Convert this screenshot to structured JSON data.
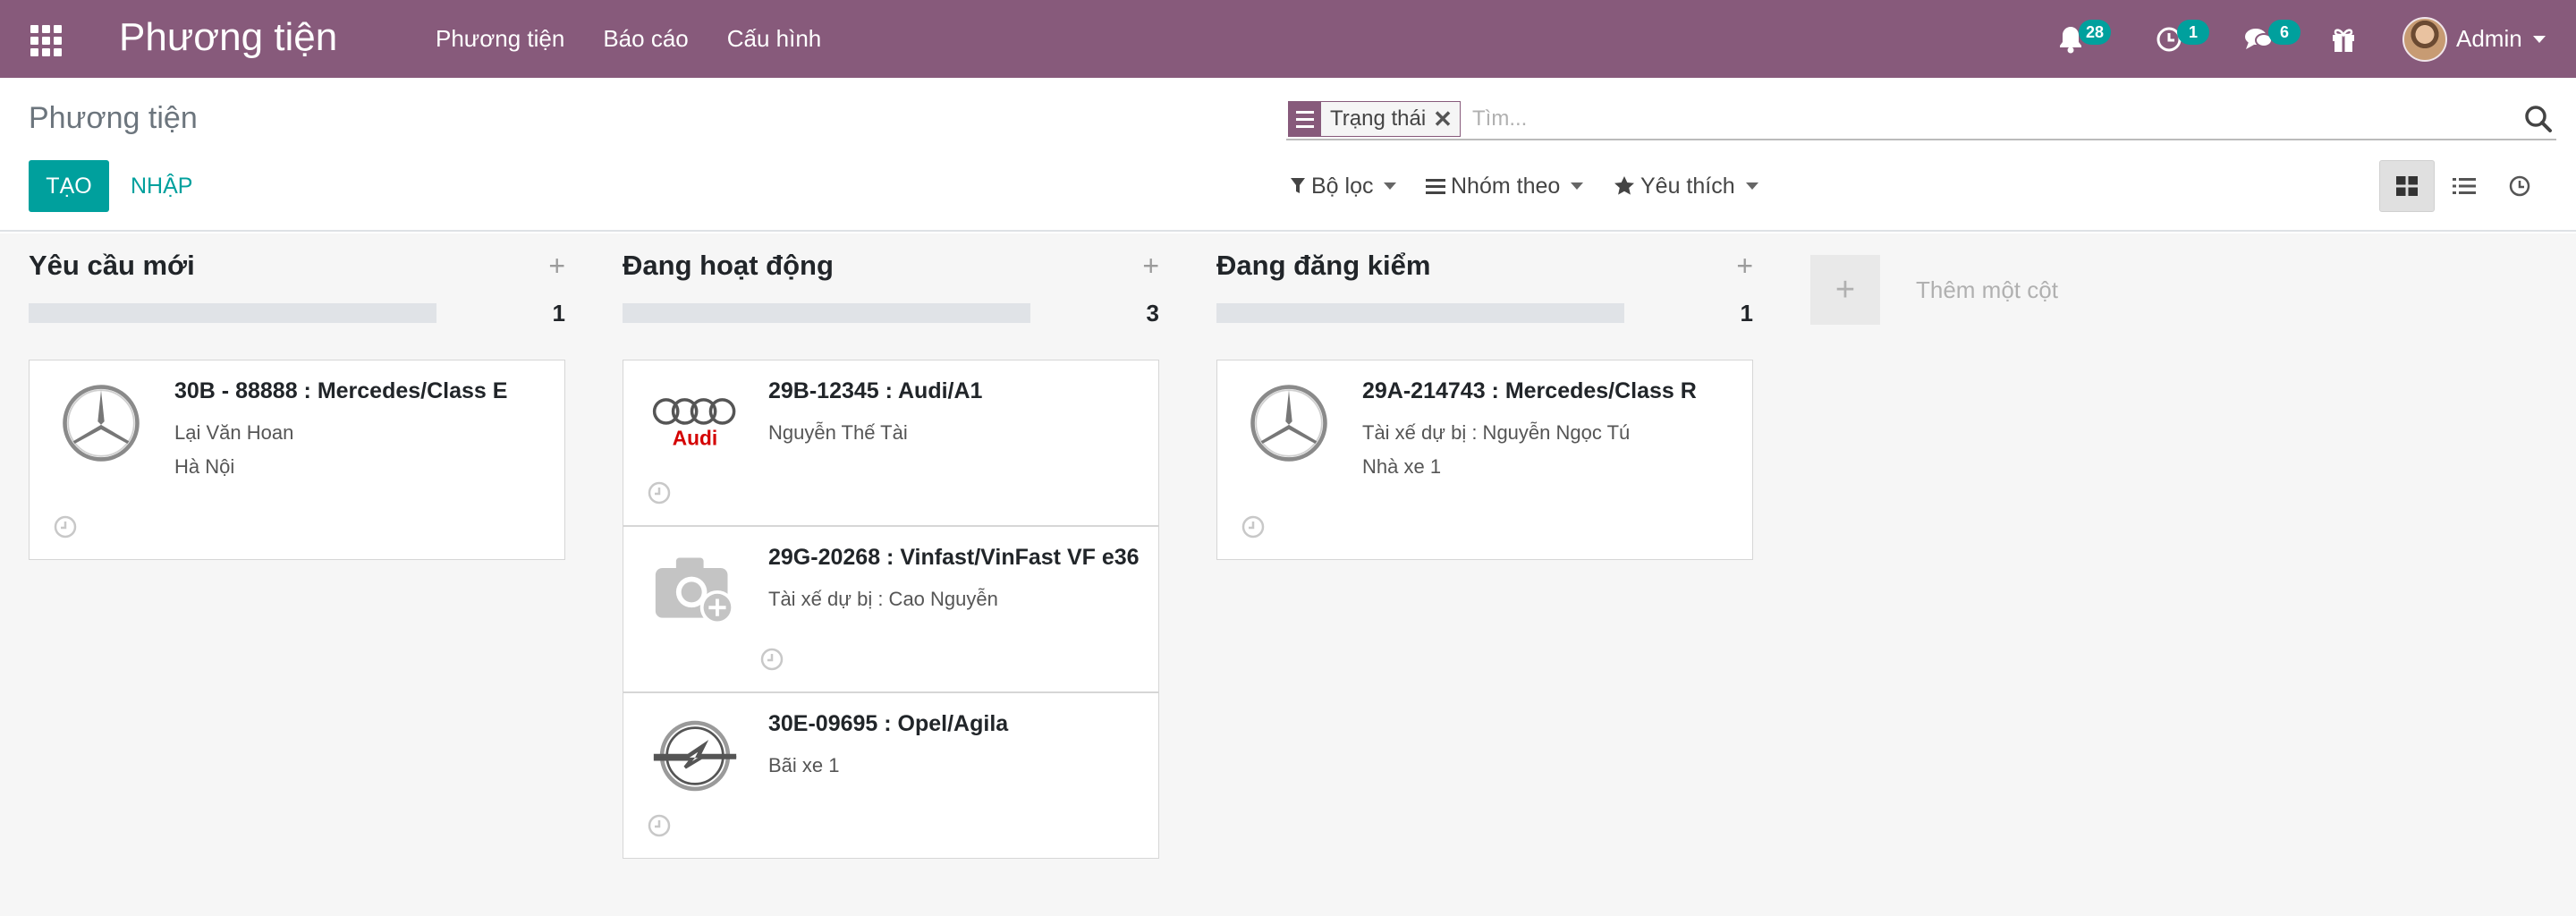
{
  "navbar": {
    "brand": "Phương tiện",
    "menu": [
      "Phương tiện",
      "Báo cáo",
      "Cấu hình"
    ],
    "notifications_count": "28",
    "activities_count": "1",
    "messages_count": "6",
    "user": "Admin"
  },
  "control_panel": {
    "title": "Phương tiện",
    "create_label": "TẠO",
    "import_label": "NHẬP",
    "search": {
      "facet": "Trạng thái",
      "placeholder": "Tìm..."
    },
    "filters_label": "Bộ lọc",
    "groupby_label": "Nhóm theo",
    "favorites_label": "Yêu thích",
    "views": [
      "kanban",
      "list",
      "activity"
    ],
    "active_view": "kanban"
  },
  "kanban": {
    "columns": [
      {
        "title": "Yêu cầu mới",
        "count": "1",
        "cards": [
          {
            "title": "30B - 88888 : Mercedes/Class E",
            "lines": [
              "Lại Văn Hoan",
              "Hà Nội"
            ],
            "logo": "mercedes-logo-icon"
          }
        ]
      },
      {
        "title": "Đang hoạt động",
        "count": "3",
        "cards": [
          {
            "title": "29B-12345 : Audi/A1",
            "lines": [
              "Nguyễn Thế Tài"
            ],
            "logo": "audi-logo-icon"
          },
          {
            "title": "29G-20268 : Vinfast/VinFast VF e36",
            "lines": [
              "Tài xế dự bị : Cao Nguyễn"
            ],
            "logo": "camera-placeholder-icon"
          },
          {
            "title": "30E-09695 : Opel/Agila",
            "lines": [
              "Bãi xe 1"
            ],
            "logo": "opel-logo-icon"
          }
        ]
      },
      {
        "title": "Đang đăng kiểm",
        "count": "1",
        "cards": [
          {
            "title": "29A-214743 : Mercedes/Class R",
            "lines": [
              "Tài xế dự bị : Nguyễn Ngọc Tú",
              "Nhà xe 1"
            ],
            "logo": "mercedes-logo-icon"
          }
        ]
      }
    ],
    "add_column_label": "Thêm một cột",
    "audi_wordmark": "Audi"
  },
  "colors": {
    "brand": "#875A7B",
    "accent": "#00A09D"
  }
}
